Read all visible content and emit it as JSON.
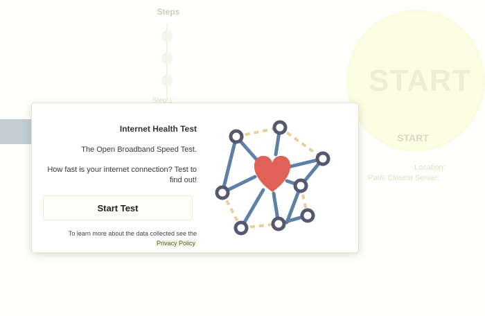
{
  "background": {
    "steps_title": "Steps",
    "steps_label": "Step 1",
    "start_label": "START",
    "start_small_label": "START",
    "location_label": "Location:",
    "closest_server_label": "Closest Server:",
    "closest_server_value": "Paris"
  },
  "modal": {
    "title": "Internet Health Test",
    "subtitle": "The Open Broadband Speed Test.",
    "question": "How fast is your internet connection? Test to find out!",
    "start_button_label": "Start Test",
    "privacy_text": "To learn more about the data collected see the",
    "privacy_link_label": "Privacy Policy"
  },
  "colors": {
    "node_stroke": "#56586f",
    "edge": "#5e7fa6",
    "dashed_edge": "#e6cf9c",
    "heart": "#e06155",
    "bar_accent": "#c1cdd1"
  },
  "icons": {
    "network": "network-heart-icon"
  }
}
